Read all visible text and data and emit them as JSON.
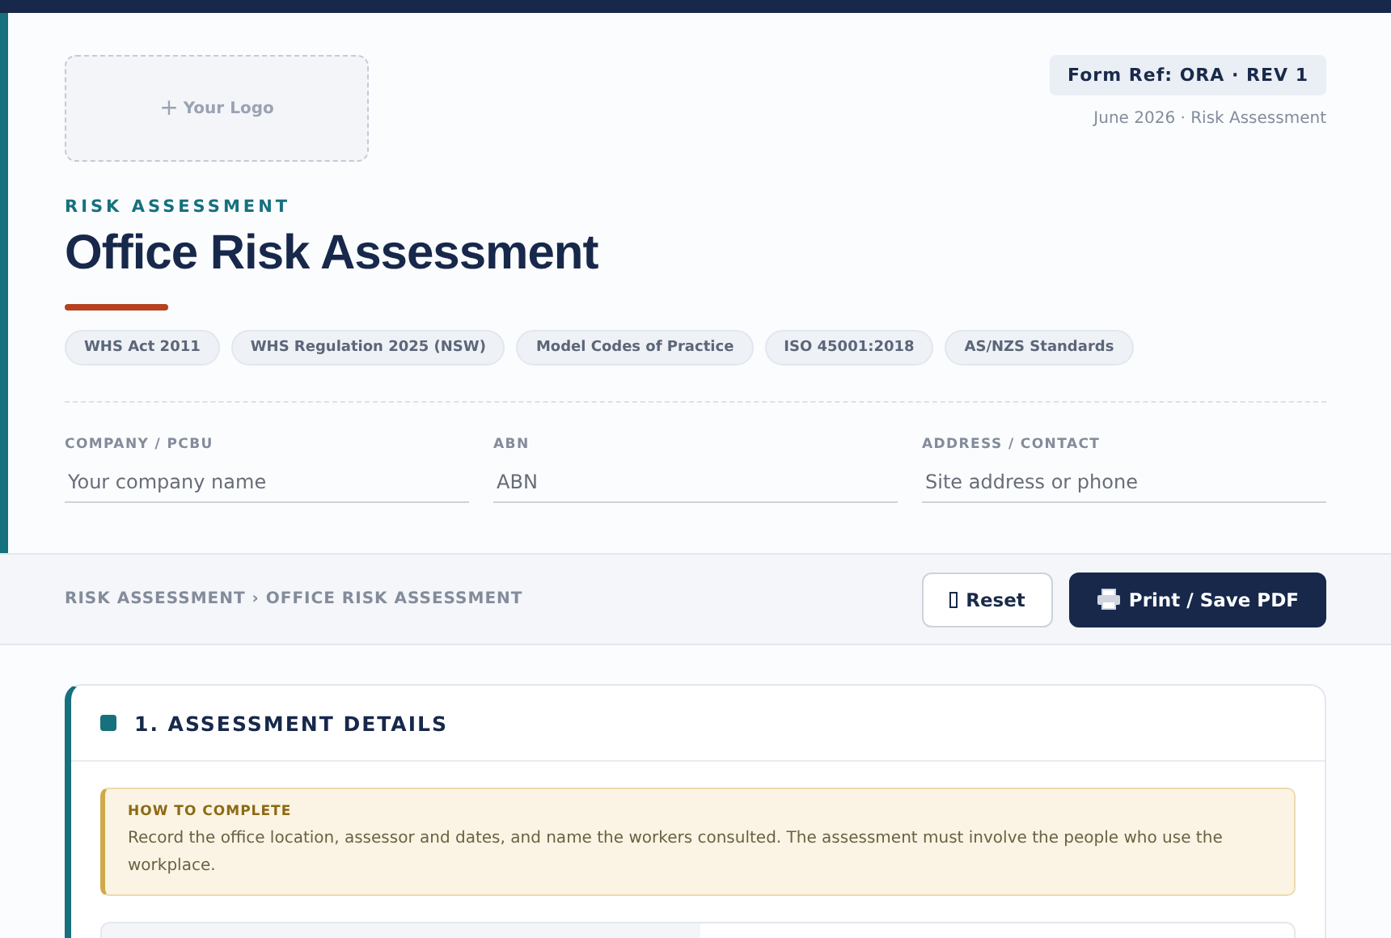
{
  "logo": {
    "icon": "+",
    "label": "Your Logo"
  },
  "form_ref": "Form Ref: ORA · REV 1",
  "date_line": "June 2026 · Risk Assessment",
  "eyebrow": "RISK ASSESSMENT",
  "title": "Office Risk Assessment",
  "tags": [
    "WHS Act 2011",
    "WHS Regulation 2025 (NSW)",
    "Model Codes of Practice",
    "ISO 45001:2018",
    "AS/NZS Standards"
  ],
  "fields": [
    {
      "label": "COMPANY / PCBU",
      "placeholder": "Your company name"
    },
    {
      "label": "ABN",
      "placeholder": "ABN"
    },
    {
      "label": "ADDRESS / CONTACT",
      "placeholder": "Site address or phone"
    }
  ],
  "breadcrumb": "RISK ASSESSMENT › OFFICE RISK ASSESSMENT",
  "buttons": [
    {
      "kind": "reset",
      "label": "Reset"
    },
    {
      "kind": "print",
      "label": "Print / Save PDF"
    }
  ],
  "section": {
    "title": "1. ASSESSMENT DETAILS",
    "note": {
      "heading": "HOW TO COMPLETE",
      "text": "Record the office location, assessor and dates, and name the workers consulted. The assessment must involve the people who use the workplace."
    }
  }
}
